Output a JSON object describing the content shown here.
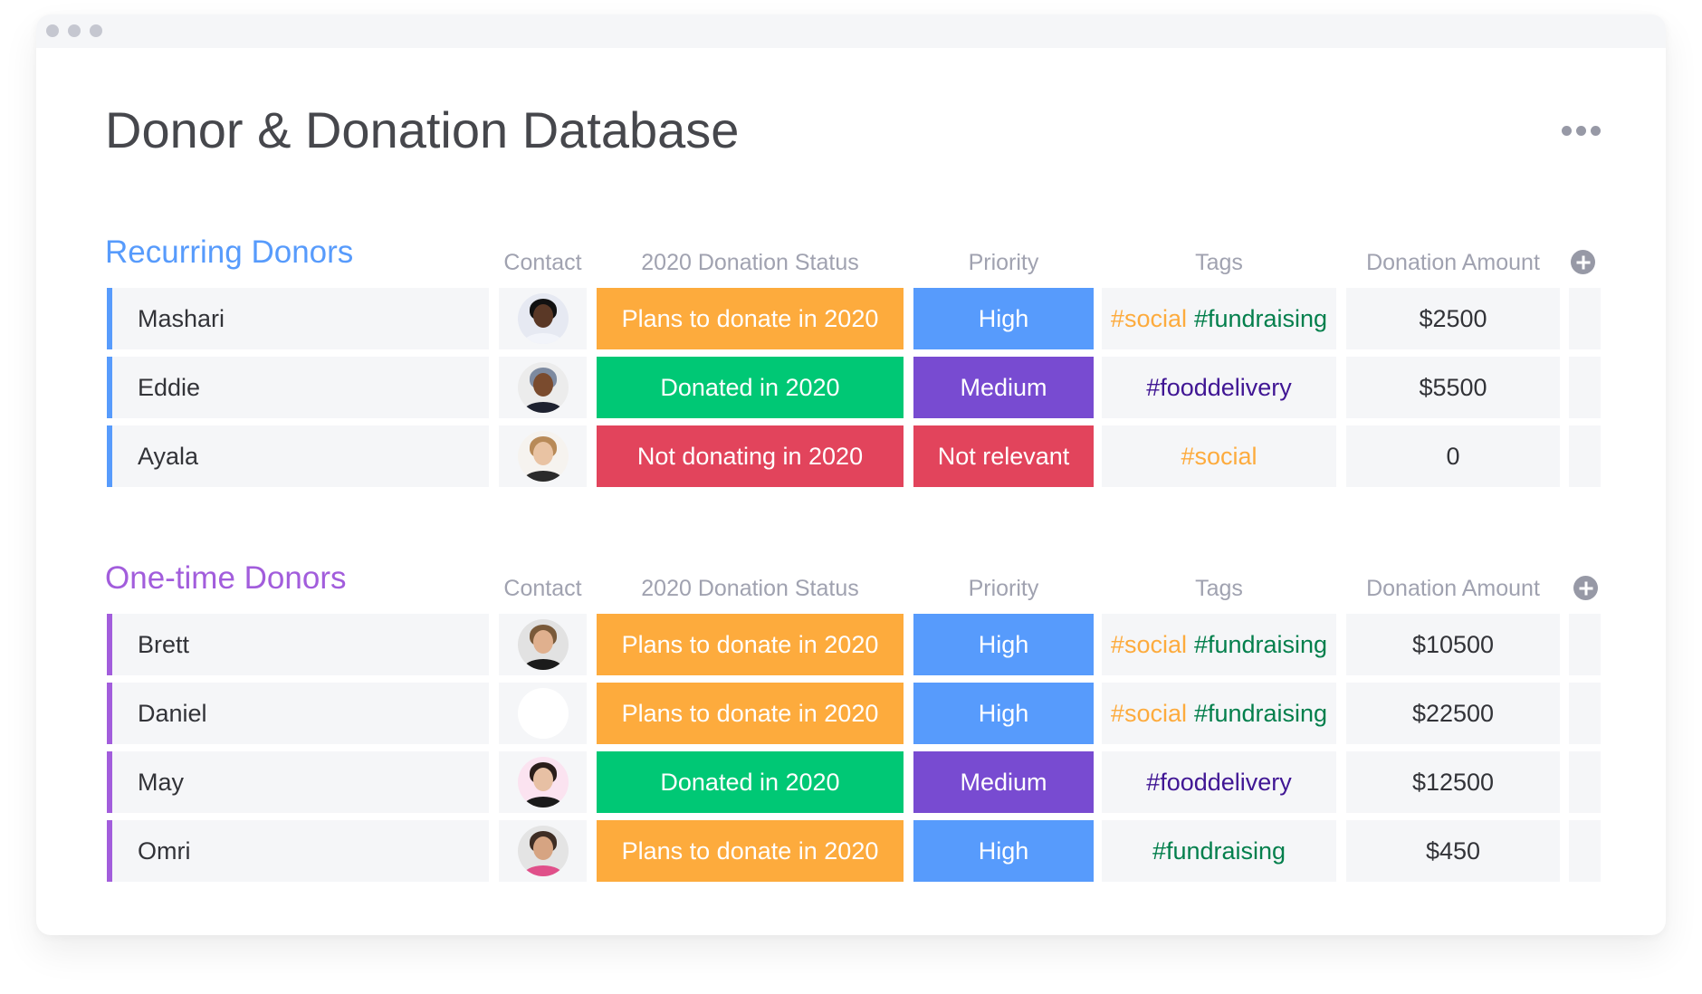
{
  "window": {
    "title": "Donor & Donation Database",
    "menu_icon": "more-horizontal-icon"
  },
  "colors": {
    "recurring_accent": "#579bfc",
    "onetime_accent": "#a25ddc",
    "status_plans": "#fdab3d",
    "status_donated": "#00c875",
    "status_not": "#e2445c",
    "priority_high": "#579bfc",
    "priority_medium": "#784bd1",
    "priority_not_relevant": "#e2445c",
    "tag_social": "#fdab3d",
    "tag_fundraising": "#037f4c",
    "tag_fooddelivery": "#401694"
  },
  "columns": {
    "contact": "Contact",
    "status": "2020 Donation Status",
    "priority": "Priority",
    "tags": "Tags",
    "amount": "Donation Amount"
  },
  "groups": [
    {
      "title": "Recurring Donors",
      "color": "#579bfc",
      "rows": [
        {
          "name": "Mashari",
          "avatar": "avatar-mashari",
          "status": "Plans to donate in 2020",
          "status_color": "#fdab3d",
          "priority": "High",
          "priority_color": "#579bfc",
          "tags": [
            {
              "text": "#social",
              "color": "#fdab3d"
            },
            {
              "text": "#fundraising",
              "color": "#037f4c"
            }
          ],
          "amount": "$2500"
        },
        {
          "name": "Eddie",
          "avatar": "avatar-eddie",
          "status": "Donated in 2020",
          "status_color": "#00c875",
          "priority": "Medium",
          "priority_color": "#784bd1",
          "tags": [
            {
              "text": "#fooddelivery",
              "color": "#401694"
            }
          ],
          "amount": "$5500"
        },
        {
          "name": "Ayala",
          "avatar": "avatar-ayala",
          "status": "Not donating in 2020",
          "status_color": "#e2445c",
          "priority": "Not relevant",
          "priority_color": "#e2445c",
          "tags": [
            {
              "text": "#social",
              "color": "#fdab3d"
            }
          ],
          "amount": "0"
        }
      ]
    },
    {
      "title": "One-time Donors",
      "color": "#a25ddc",
      "rows": [
        {
          "name": "Brett",
          "avatar": "avatar-brett",
          "status": "Plans to donate in 2020",
          "status_color": "#fdab3d",
          "priority": "High",
          "priority_color": "#579bfc",
          "tags": [
            {
              "text": "#social",
              "color": "#fdab3d"
            },
            {
              "text": "#fundraising",
              "color": "#037f4c"
            }
          ],
          "amount": "$10500"
        },
        {
          "name": "Daniel",
          "avatar": "avatar-daniel",
          "status": "Plans to donate in 2020",
          "status_color": "#fdab3d",
          "priority": "High",
          "priority_color": "#579bfc",
          "tags": [
            {
              "text": "#social",
              "color": "#fdab3d"
            },
            {
              "text": "#fundraising",
              "color": "#037f4c"
            }
          ],
          "amount": "$22500"
        },
        {
          "name": "May",
          "avatar": "avatar-may",
          "status": "Donated in 2020",
          "status_color": "#00c875",
          "priority": "Medium",
          "priority_color": "#784bd1",
          "tags": [
            {
              "text": "#fooddelivery",
              "color": "#401694"
            }
          ],
          "amount": "$12500"
        },
        {
          "name": "Omri",
          "avatar": "avatar-omri",
          "status": "Plans to donate in 2020",
          "status_color": "#fdab3d",
          "priority": "High",
          "priority_color": "#579bfc",
          "tags": [
            {
              "text": "#fundraising",
              "color": "#037f4c"
            }
          ],
          "amount": "$450"
        }
      ]
    }
  ]
}
